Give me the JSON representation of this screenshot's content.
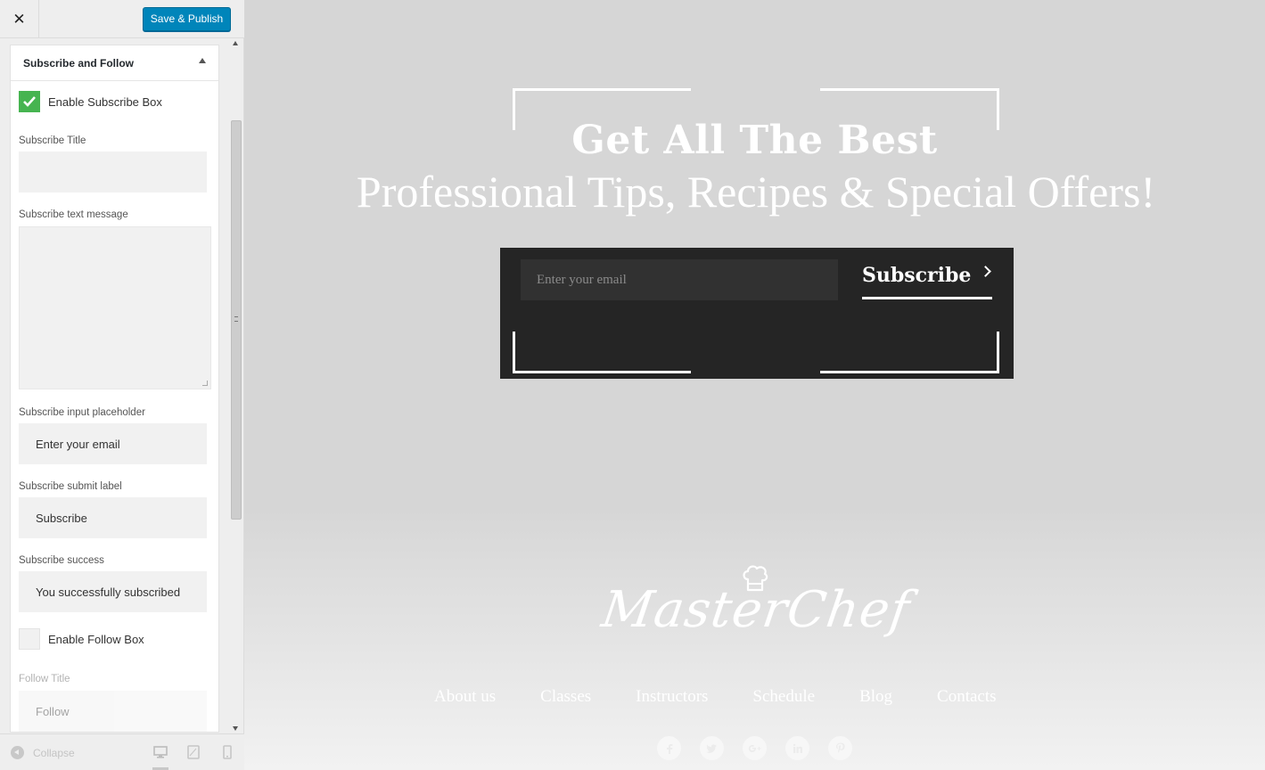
{
  "sidebar": {
    "close_icon": "close-icon",
    "save_label": "Save & Publish",
    "section_title": "Subscribe and Follow",
    "enable_subscribe": {
      "label": "Enable Subscribe Box",
      "checked": true
    },
    "fields": {
      "subscribe_title": {
        "label": "Subscribe Title",
        "value": ""
      },
      "subscribe_text": {
        "label": "Subscribe text message",
        "value": ""
      },
      "subscribe_placeholder": {
        "label": "Subscribe input placeholder",
        "value": "Enter your email"
      },
      "subscribe_submit": {
        "label": "Subscribe submit label",
        "value": "Subscribe"
      },
      "subscribe_success": {
        "label": "Subscribe success",
        "value": "You successfully subscribed"
      }
    },
    "enable_follow": {
      "label": "Enable Follow Box",
      "checked": false
    },
    "follow_title": {
      "label": "Follow Title",
      "value": "Follow"
    },
    "collapse_label": "Collapse",
    "devices": [
      "desktop-icon",
      "tablet-icon",
      "mobile-icon"
    ]
  },
  "preview": {
    "headline_1": "Get All The Best",
    "headline_2": "Professional Tips, Recipes & Special Offers!",
    "email_placeholder": "Enter your email",
    "subscribe_button": "Subscribe",
    "logo_text": "MasterChef",
    "nav": [
      "About us",
      "Classes",
      "Instructors",
      "Schedule",
      "Blog",
      "Contacts"
    ],
    "social_icons": [
      "facebook-icon",
      "twitter-icon",
      "google-plus-icon",
      "linkedin-icon",
      "pinterest-icon"
    ]
  },
  "colors": {
    "primary_button": "#0085ba",
    "checkbox_on": "#46b450",
    "preview_bg": "#d6d6d6",
    "subscribe_box": "#252525"
  }
}
